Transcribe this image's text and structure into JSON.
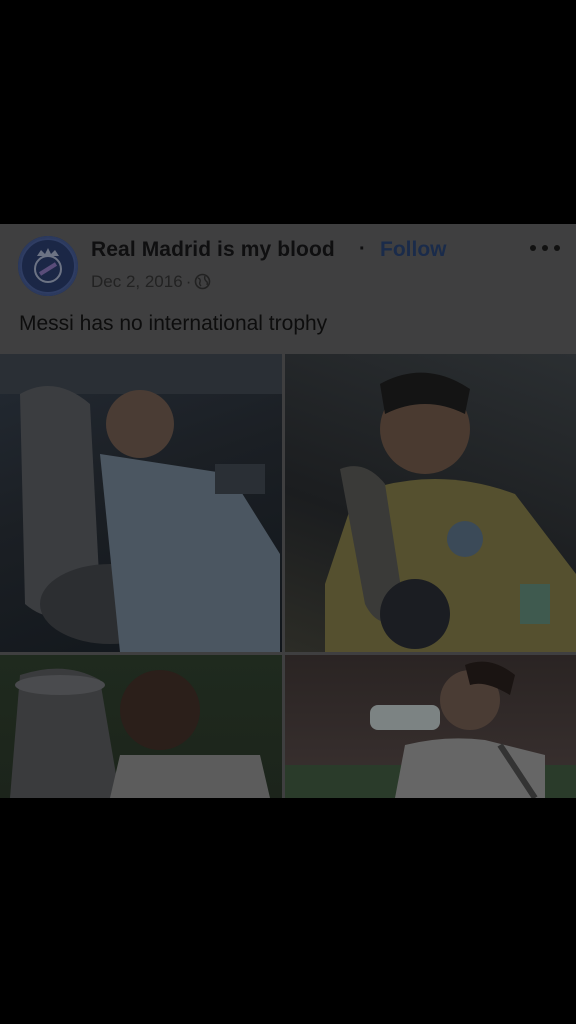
{
  "post": {
    "page_name": "Real Madrid is my blood",
    "separator": "·",
    "follow_label": "Follow",
    "date": "Dec 2, 2016",
    "meta_separator": "·",
    "audience_icon": "globe-icon",
    "more_icon": "more-options-icon",
    "text": "Messi has no international trophy",
    "avatar_icon": "real-madrid-crest-icon",
    "photos": [
      {
        "name": "photo-player-kissing-copa-america-trophy"
      },
      {
        "name": "photo-player-kissing-confederations-cup-trophy"
      },
      {
        "name": "photo-player-kissing-euro-trophy"
      },
      {
        "name": "photo-player-drinking-water-bottle"
      }
    ]
  },
  "colors": {
    "backdrop": "#000000",
    "card_dimmed": "#3f3f40",
    "follow_text": "#1a2b4a"
  }
}
